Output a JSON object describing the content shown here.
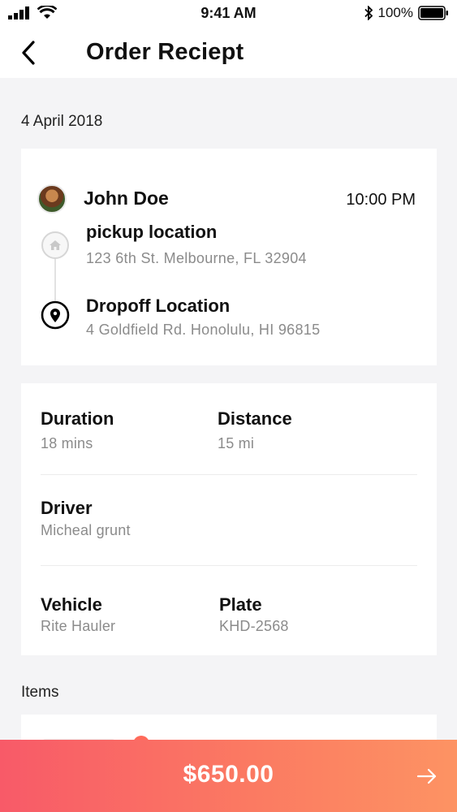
{
  "status_bar": {
    "time": "9:41 AM",
    "battery": "100%"
  },
  "header": {
    "title": "Order Reciept"
  },
  "order": {
    "date": "4 April 2018"
  },
  "trip": {
    "rider_name": "John Doe",
    "time": "10:00 PM",
    "pickup": {
      "label": "pickup location",
      "address": "123 6th St. Melbourne, FL 32904"
    },
    "dropoff": {
      "label": "Dropoff Location",
      "address": "4 Goldfield Rd. Honolulu, HI 96815"
    }
  },
  "details": {
    "duration": {
      "label": "Duration",
      "value": "18 mins"
    },
    "distance": {
      "label": "Distance",
      "value": "15 mi"
    },
    "driver": {
      "label": "Driver",
      "value": "Micheal grunt"
    },
    "vehicle": {
      "label": "Vehicle",
      "value": "Rite Hauler"
    },
    "plate": {
      "label": "Plate",
      "value": "KHD-2568"
    }
  },
  "items": {
    "heading": "Items"
  },
  "total": {
    "amount": "$650.00"
  },
  "colors": {
    "accent_start": "#f85a68",
    "accent_end": "#fd9363",
    "muted_text": "#8b8b8b"
  },
  "icons": [
    "signal-icon",
    "wifi-icon",
    "bluetooth-icon",
    "battery-icon",
    "back-chevron-icon",
    "home-icon",
    "location-pin-icon",
    "arrow-right-icon"
  ]
}
